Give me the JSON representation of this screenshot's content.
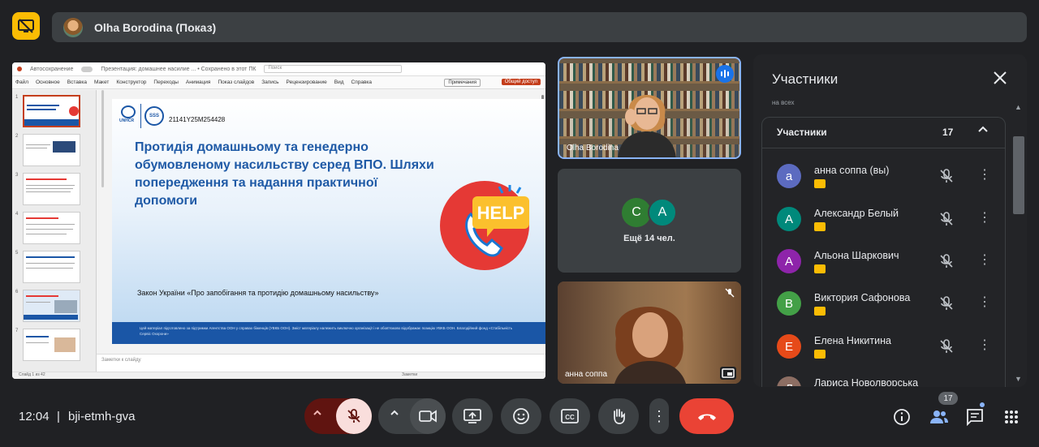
{
  "presenter": {
    "name": "Olha Borodina (Показ)"
  },
  "powerpoint": {
    "title_autosave": "Автосохранение",
    "title_doc": "Презентация: домашнее насилие ...  •  Сохранено в этот ПК",
    "search": "Поиск",
    "menu": [
      "Файл",
      "Основное",
      "Вставка",
      "Макет",
      "Конструктор",
      "Переходы",
      "Анимация",
      "Показ слайдов",
      "Запись",
      "Рецензирование",
      "Вид",
      "Справка"
    ],
    "comments": "Примечания",
    "share": "Общий доступ",
    "notes": "Заметки к слайду",
    "status_left": "Слайд 1 из 42",
    "status_right": "Заметки"
  },
  "slide": {
    "logo_text": "UNHCR",
    "sss_text": "SSS",
    "code": "21141Y25M254428",
    "title": "Протидія домашньому та генедерно обумовленому насильству серед ВПО. Шляхи попередження та надання практичної допомоги",
    "law": "Закон України «Про запобігання та протидію домашньому насильству»",
    "footer": "Цей матеріал підготовлено за підтримки Агентства ООН у справах біженців (УВКБ ООН). Зміст матеріалу належить виключно організації і не обов'язково відображає позицію УВКБ ООН. Благодійний фонд «Стабільність Сервіс Охорони»",
    "help_label": "HELP"
  },
  "tiles": [
    {
      "name": "Olha Borodina"
    },
    {
      "more_label": "Ещё 14 чел.",
      "avatars": [
        {
          "letter": "C",
          "color": "#2f7d32"
        },
        {
          "letter": "A",
          "color": "#00897b"
        }
      ]
    },
    {
      "name": "анна соппа"
    }
  ],
  "participants_panel": {
    "title": "Участники",
    "cut_text": "на всех",
    "group_label": "Участники",
    "group_count": "17",
    "people": [
      {
        "name": "анна соппа (вы)",
        "letter": "а",
        "color": "#5c6bc0"
      },
      {
        "name": "Александр Белый",
        "letter": "А",
        "color": "#00897b"
      },
      {
        "name": "Альона Шаркович",
        "letter": "А",
        "color": "#8e24aa"
      },
      {
        "name": "Виктория Сафонова",
        "letter": "В",
        "color": "#43a047"
      },
      {
        "name": "Елена Никитина",
        "letter": "Е",
        "color": "#e64a19"
      },
      {
        "name": "Лариса Новолворська",
        "letter": "Л",
        "color": "#8d6e63"
      }
    ]
  },
  "bottom_bar": {
    "time": "12:04",
    "separator": "|",
    "meeting_code": "bji-etmh-gva",
    "people_count": "17"
  },
  "colors": {
    "accent_yellow": "#fbbc04",
    "end_call": "#ea4335",
    "speaking": "#1a73e8",
    "background": "#202124"
  }
}
